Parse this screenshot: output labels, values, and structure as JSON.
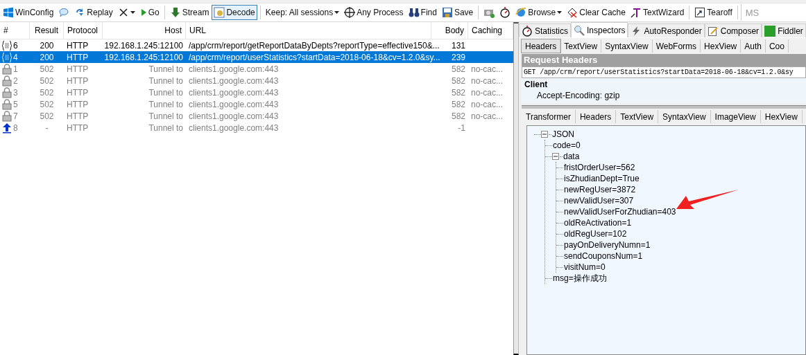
{
  "toolbar": [
    [
      {
        "label": "WinConfig",
        "dropdown": false,
        "selected": false
      },
      {
        "dropdown": false,
        "selected": false
      },
      {
        "label": "Replay",
        "dropdown": false,
        "selected": false
      },
      {
        "dropdown": true,
        "selected": false
      },
      {
        "label": "Go",
        "dropdown": false,
        "selected": false
      }
    ],
    [
      {
        "label": "Stream",
        "dropdown": false,
        "selected": false
      },
      {
        "label": "Decode",
        "dropdown": false,
        "selected": true
      }
    ],
    [
      {
        "label": "Keep: All sessions",
        "dropdown": true,
        "selected": false
      },
      {
        "label": "Any Process",
        "dropdown": false,
        "selected": false
      },
      {
        "label": "Find",
        "dropdown": false,
        "selected": false
      },
      {
        "label": "Save",
        "dropdown": false,
        "selected": false
      }
    ],
    [
      {
        "dropdown": false,
        "selected": false
      },
      {
        "dropdown": false,
        "selected": false
      },
      {
        "label": "Browse",
        "dropdown": true,
        "selected": false
      },
      {
        "label": "Clear Cache",
        "dropdown": false,
        "selected": false
      },
      {
        "label": "TextWizard",
        "dropdown": false,
        "selected": false
      }
    ],
    [
      {
        "label": "Tearoff",
        "dropdown": false,
        "selected": false
      }
    ]
  ],
  "search": {
    "placeholder": "MS"
  },
  "sessions": {
    "columns": [
      "#",
      "Result",
      "Protocol",
      "Host",
      "URL",
      "Body",
      "Caching"
    ],
    "rows": [
      {
        "kind": "json",
        "cells": [
          "6",
          "200",
          "HTTP",
          "192.168.1.245:12100",
          "/app/crm/report/getReportDataByDepts?reportType=effective150&...",
          "131",
          ""
        ],
        "selected": false
      },
      {
        "kind": "json",
        "cells": [
          "4",
          "200",
          "HTTP",
          "192.168.1.245:12100",
          "/app/crm/report/userStatistics?startData=2018-06-18&cv=1.2.0&sy...",
          "239",
          ""
        ],
        "selected": true
      },
      {
        "kind": "tunnel",
        "cells": [
          "1",
          "502",
          "HTTP",
          "Tunnel to",
          "clients1.google.com:443",
          "582",
          "no-cac..."
        ],
        "selected": false
      },
      {
        "kind": "tunnel",
        "cells": [
          "2",
          "502",
          "HTTP",
          "Tunnel to",
          "clients1.google.com:443",
          "582",
          "no-cac..."
        ],
        "selected": false
      },
      {
        "kind": "tunnel",
        "cells": [
          "3",
          "502",
          "HTTP",
          "Tunnel to",
          "clients1.google.com:443",
          "582",
          "no-cac..."
        ],
        "selected": false
      },
      {
        "kind": "tunnel",
        "cells": [
          "5",
          "502",
          "HTTP",
          "Tunnel to",
          "clients1.google.com:443",
          "582",
          "no-cac..."
        ],
        "selected": false
      },
      {
        "kind": "tunnel",
        "cells": [
          "7",
          "502",
          "HTTP",
          "Tunnel to",
          "clients1.google.com:443",
          "582",
          "no-cac..."
        ],
        "selected": false
      },
      {
        "kind": "upload",
        "cells": [
          "8",
          "-",
          "HTTP",
          "Tunnel to",
          "clients1.google.com:443",
          "-1",
          ""
        ],
        "selected": false
      }
    ]
  },
  "main_tabs": [
    {
      "label": "Statistics",
      "selected": false
    },
    {
      "label": "Inspectors",
      "selected": true
    },
    {
      "label": "AutoResponder",
      "selected": false
    },
    {
      "label": "Composer",
      "selected": false
    },
    {
      "label": "Fiddler",
      "selected": false
    }
  ],
  "request_tabs": [
    {
      "label": "Headers",
      "selected": true
    },
    {
      "label": "TextView",
      "selected": false
    },
    {
      "label": "SyntaxView",
      "selected": false
    },
    {
      "label": "WebForms",
      "selected": false
    },
    {
      "label": "HexView",
      "selected": false
    },
    {
      "label": "Auth",
      "selected": false
    },
    {
      "label": "Coo",
      "selected": false
    }
  ],
  "request_headers": {
    "title": "Request Headers",
    "request_line": "GET /app/crm/report/userStatistics?startData=2018-06-18&cv=1.2.0&sy",
    "groups": [
      {
        "name": "Client",
        "headers": [
          "Accept-Encoding: gzip"
        ]
      }
    ]
  },
  "response_tabs": [
    {
      "label": "Transformer",
      "selected": false
    },
    {
      "label": "Headers",
      "selected": false
    },
    {
      "label": "TextView",
      "selected": false
    },
    {
      "label": "SyntaxView",
      "selected": false
    },
    {
      "label": "ImageView",
      "selected": false
    },
    {
      "label": "HexView",
      "selected": false
    }
  ],
  "json_tree": [
    {
      "label": "JSON",
      "expanded": true,
      "children": [
        {
          "label": "code=0"
        },
        {
          "label": "data",
          "expanded": true,
          "children": [
            {
              "label": "fristOrderUser=562"
            },
            {
              "label": "isZhudianDept=True"
            },
            {
              "label": "newRegUser=3872"
            },
            {
              "label": "newValidUser=307"
            },
            {
              "label": "newValidUserForZhudian=403"
            },
            {
              "label": "oldReActivation=1"
            },
            {
              "label": "oldRegUser=102"
            },
            {
              "label": "payOnDeliveryNumn=1"
            },
            {
              "label": "sendCouponsNum=1"
            },
            {
              "label": "visitNum=0"
            }
          ]
        },
        {
          "label": "msg=操作成功"
        }
      ]
    }
  ]
}
